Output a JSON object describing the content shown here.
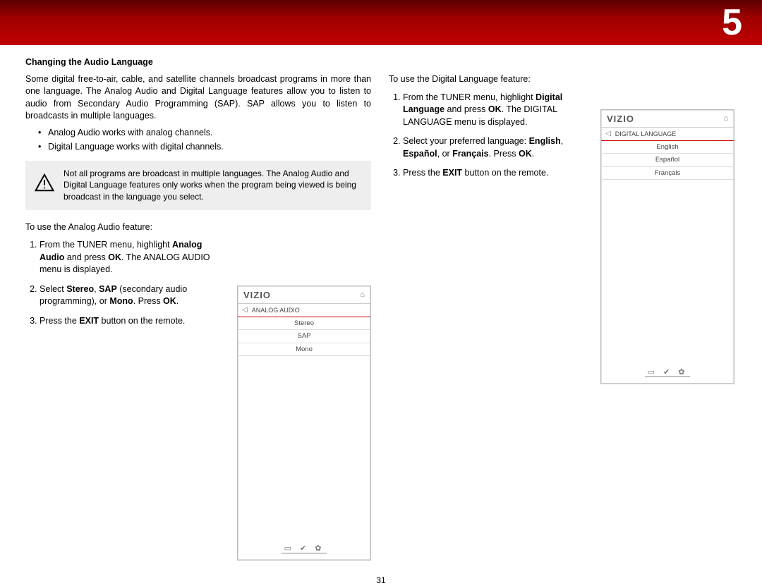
{
  "chapter": "5",
  "page_number": "31",
  "col1": {
    "heading": "Changing the Audio Language",
    "para1": "Some digital free-to-air, cable, and satellite channels broadcast programs in more than one language. The Analog Audio and Digital Language features allow you to listen to audio from Secondary Audio Programming (SAP). SAP allows you to listen to broadcasts in multiple languages.",
    "bullet1": "Analog Audio works with analog channels.",
    "bullet2": "Digital Language works with digital channels.",
    "warn": "Not all programs are broadcast in multiple languages. The Analog Audio and Digital Language features only works when the program being viewed is being broadcast in the language you select.",
    "intro2": "To use the Analog Audio feature:",
    "step1_a": "From the TUNER menu, highlight ",
    "step1_b": "Analog Audio",
    "step1_c": " and press ",
    "step1_d": "OK",
    "step1_e": ". The ANALOG AUDIO menu is displayed.",
    "step2_a": "Select ",
    "step2_b": "Stereo",
    "step2_c": ", ",
    "step2_d": "SAP",
    "step2_e": " (secondary audio programming), or ",
    "step2_f": "Mono",
    "step2_g": ". Press ",
    "step2_h": "OK",
    "step2_i": ".",
    "step3_a": "Press the ",
    "step3_b": "EXIT",
    "step3_c": " button on the remote."
  },
  "col2": {
    "intro": "To use the Digital Language feature:",
    "step1_a": "From the TUNER menu, highlight ",
    "step1_b": "Digital Language",
    "step1_c": " and press ",
    "step1_d": "OK",
    "step1_e": ". The DIGITAL LANGUAGE menu is displayed.",
    "step2_a": "Select your preferred language: ",
    "step2_b": "English",
    "step2_c": ", ",
    "step2_d": "Español",
    "step2_e": ", or ",
    "step2_f": "Français",
    "step2_g": ". Press ",
    "step2_h": "OK",
    "step2_i": ".",
    "step3_a": "Press the ",
    "step3_b": "EXIT",
    "step3_c": " button on the remote."
  },
  "tv": {
    "logo": "VIZIO",
    "menu1": {
      "title": "ANALOG AUDIO",
      "i1": "Stereo",
      "i2": "SAP",
      "i3": "Mono"
    },
    "menu2": {
      "title": "DIGITAL LANGUAGE",
      "i1": "English",
      "i2": "Español",
      "i3": "Français"
    }
  }
}
